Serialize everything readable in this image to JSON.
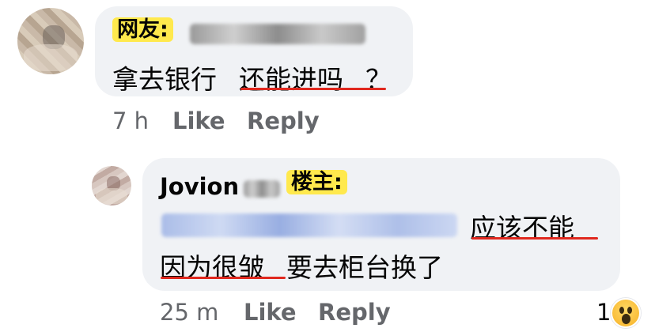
{
  "comment1": {
    "tag": "网友:",
    "name_blurred": "[blurred name]",
    "text_part1": "拿去银行",
    "text_part2": "还能进吗",
    "text_part3": "？",
    "time": "7 h",
    "like": "Like",
    "reply": "Reply"
  },
  "comment2": {
    "author": "Jovion",
    "tag": "楼主:",
    "mention_blurred": "[blurred mention]",
    "line1_underlined": "应该不能",
    "line2_underlined": "因为很皱",
    "line2_rest": " 要去柜台换了",
    "time": "25 m",
    "like": "Like",
    "reply": "Reply",
    "reaction_count": "1",
    "reaction_icon": "wow-emoji-icon"
  },
  "colors": {
    "bubble": "#f0f2f5",
    "highlight": "#ffe94d",
    "underline": "#e0281e",
    "meta": "#65676b"
  }
}
